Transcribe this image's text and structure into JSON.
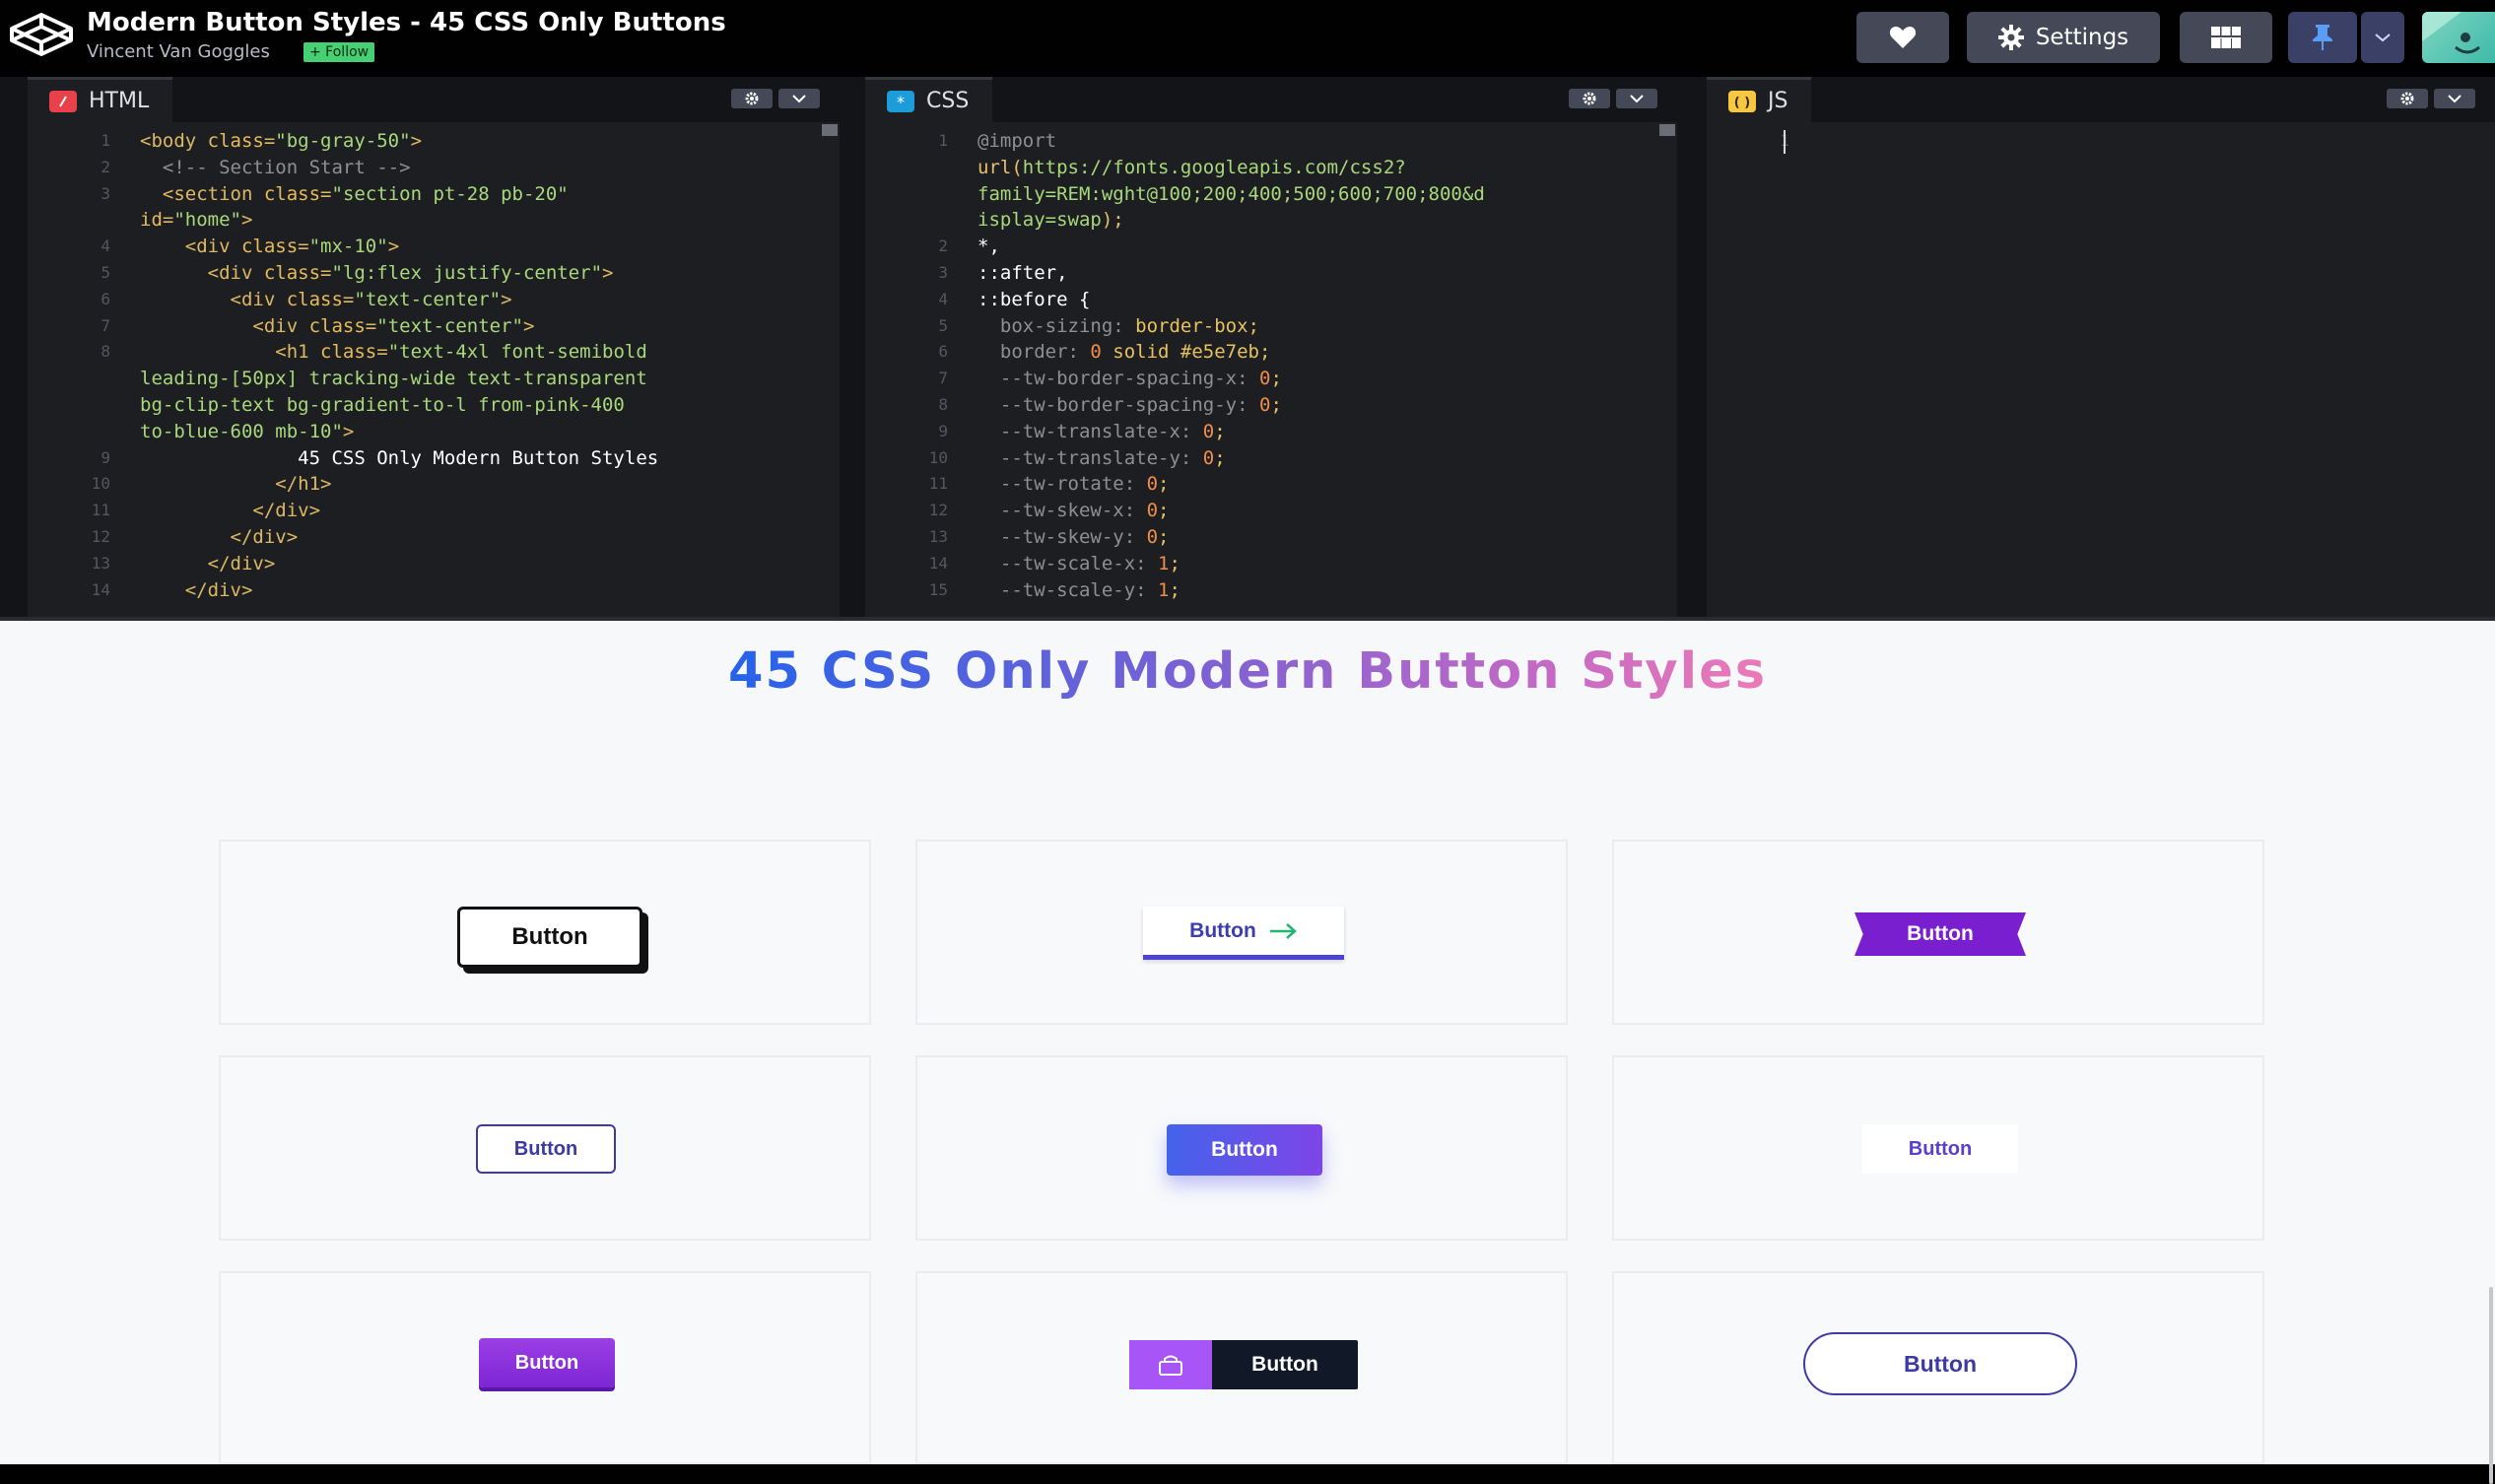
{
  "header": {
    "title": "Modern Button Styles - 45 CSS Only Buttons",
    "author": "Vincent Van Goggles",
    "follow_label": "+ Follow",
    "settings_label": "Settings"
  },
  "panes": {
    "html": {
      "label": "HTML",
      "lines": [
        {
          "n": "1",
          "parts": [
            {
              "c": "tag",
              "t": "<body "
            },
            {
              "c": "attr",
              "t": "class"
            },
            {
              "c": "tag",
              "t": "="
            },
            {
              "c": "str",
              "t": "\"bg-gray-50\""
            },
            {
              "c": "tag",
              "t": ">"
            }
          ]
        },
        {
          "n": "2",
          "parts": [
            {
              "c": "cmt",
              "t": "  <!-- Section Start -->"
            }
          ]
        },
        {
          "n": "3",
          "parts": [
            {
              "c": "tag",
              "t": "  <section "
            },
            {
              "c": "attr",
              "t": "class"
            },
            {
              "c": "tag",
              "t": "="
            },
            {
              "c": "str",
              "t": "\"section pt-28 pb-20\""
            }
          ]
        },
        {
          "n": "",
          "parts": [
            {
              "c": "attr",
              "t": "id"
            },
            {
              "c": "tag",
              "t": "="
            },
            {
              "c": "str",
              "t": "\"home\""
            },
            {
              "c": "tag",
              "t": ">"
            }
          ]
        },
        {
          "n": "4",
          "parts": [
            {
              "c": "tag",
              "t": "    <div "
            },
            {
              "c": "attr",
              "t": "class"
            },
            {
              "c": "tag",
              "t": "="
            },
            {
              "c": "str",
              "t": "\"mx-10\""
            },
            {
              "c": "tag",
              "t": ">"
            }
          ]
        },
        {
          "n": "5",
          "parts": [
            {
              "c": "tag",
              "t": "      <div "
            },
            {
              "c": "attr",
              "t": "class"
            },
            {
              "c": "tag",
              "t": "="
            },
            {
              "c": "str",
              "t": "\"lg:flex justify-center\""
            },
            {
              "c": "tag",
              "t": ">"
            }
          ]
        },
        {
          "n": "6",
          "parts": [
            {
              "c": "tag",
              "t": "        <div "
            },
            {
              "c": "attr",
              "t": "class"
            },
            {
              "c": "tag",
              "t": "="
            },
            {
              "c": "str",
              "t": "\"text-center\""
            },
            {
              "c": "tag",
              "t": ">"
            }
          ]
        },
        {
          "n": "7",
          "parts": [
            {
              "c": "tag",
              "t": "          <div "
            },
            {
              "c": "attr",
              "t": "class"
            },
            {
              "c": "tag",
              "t": "="
            },
            {
              "c": "str",
              "t": "\"text-center\""
            },
            {
              "c": "tag",
              "t": ">"
            }
          ]
        },
        {
          "n": "8",
          "parts": [
            {
              "c": "tag",
              "t": "            <h1 "
            },
            {
              "c": "attr",
              "t": "class"
            },
            {
              "c": "tag",
              "t": "="
            },
            {
              "c": "str",
              "t": "\"text-4xl font-semibold"
            }
          ]
        },
        {
          "n": "",
          "parts": [
            {
              "c": "str",
              "t": "leading-[50px] tracking-wide text-transparent"
            }
          ]
        },
        {
          "n": "",
          "parts": [
            {
              "c": "str",
              "t": "bg-clip-text bg-gradient-to-l from-pink-400"
            }
          ]
        },
        {
          "n": "",
          "parts": [
            {
              "c": "str",
              "t": "to-blue-600 mb-10\""
            },
            {
              "c": "tag",
              "t": ">"
            }
          ]
        },
        {
          "n": "9",
          "parts": [
            {
              "c": "plain",
              "t": "              45 CSS Only Modern Button Styles"
            }
          ]
        },
        {
          "n": "10",
          "parts": [
            {
              "c": "tag",
              "t": "            </h1>"
            }
          ]
        },
        {
          "n": "11",
          "parts": [
            {
              "c": "tag",
              "t": "          </div>"
            }
          ]
        },
        {
          "n": "12",
          "parts": [
            {
              "c": "tag",
              "t": "        </div>"
            }
          ]
        },
        {
          "n": "13",
          "parts": [
            {
              "c": "tag",
              "t": "      </div>"
            }
          ]
        },
        {
          "n": "14",
          "parts": [
            {
              "c": "tag",
              "t": "    </div>"
            }
          ]
        }
      ]
    },
    "css": {
      "label": "CSS",
      "lines": [
        {
          "n": "1",
          "parts": [
            {
              "c": "cmt",
              "t": "@import"
            }
          ]
        },
        {
          "n": "",
          "parts": [
            {
              "c": "kw",
              "t": "url("
            },
            {
              "c": "str",
              "t": "https://fonts.googleapis.com/css2?"
            }
          ]
        },
        {
          "n": "",
          "parts": [
            {
              "c": "str",
              "t": "family=REM:wght@100;200;400;500;600;700;800&d"
            }
          ]
        },
        {
          "n": "",
          "parts": [
            {
              "c": "str",
              "t": "isplay=swap"
            },
            {
              "c": "kw",
              "t": ");"
            }
          ]
        },
        {
          "n": "2",
          "parts": [
            {
              "c": "sel",
              "t": "*,"
            }
          ]
        },
        {
          "n": "3",
          "parts": [
            {
              "c": "sel",
              "t": "::after,"
            }
          ]
        },
        {
          "n": "4",
          "parts": [
            {
              "c": "sel",
              "t": "::before {"
            }
          ]
        },
        {
          "n": "5",
          "parts": [
            {
              "c": "cmt",
              "t": "  box-sizing: "
            },
            {
              "c": "prop",
              "t": "border-box;"
            }
          ]
        },
        {
          "n": "6",
          "parts": [
            {
              "c": "cmt",
              "t": "  border: "
            },
            {
              "c": "num",
              "t": "0"
            },
            {
              "c": "prop",
              "t": " solid #e5e7eb;"
            }
          ]
        },
        {
          "n": "7",
          "parts": [
            {
              "c": "cmt",
              "t": "  --tw-border-spacing-x: "
            },
            {
              "c": "num",
              "t": "0"
            },
            {
              "c": "prop",
              "t": ";"
            }
          ]
        },
        {
          "n": "8",
          "parts": [
            {
              "c": "cmt",
              "t": "  --tw-border-spacing-y: "
            },
            {
              "c": "num",
              "t": "0"
            },
            {
              "c": "prop",
              "t": ";"
            }
          ]
        },
        {
          "n": "9",
          "parts": [
            {
              "c": "cmt",
              "t": "  --tw-translate-x: "
            },
            {
              "c": "num",
              "t": "0"
            },
            {
              "c": "prop",
              "t": ";"
            }
          ]
        },
        {
          "n": "10",
          "parts": [
            {
              "c": "cmt",
              "t": "  --tw-translate-y: "
            },
            {
              "c": "num",
              "t": "0"
            },
            {
              "c": "prop",
              "t": ";"
            }
          ]
        },
        {
          "n": "11",
          "parts": [
            {
              "c": "cmt",
              "t": "  --tw-rotate: "
            },
            {
              "c": "num",
              "t": "0"
            },
            {
              "c": "prop",
              "t": ";"
            }
          ]
        },
        {
          "n": "12",
          "parts": [
            {
              "c": "cmt",
              "t": "  --tw-skew-x: "
            },
            {
              "c": "num",
              "t": "0"
            },
            {
              "c": "prop",
              "t": ";"
            }
          ]
        },
        {
          "n": "13",
          "parts": [
            {
              "c": "cmt",
              "t": "  --tw-skew-y: "
            },
            {
              "c": "num",
              "t": "0"
            },
            {
              "c": "prop",
              "t": ";"
            }
          ]
        },
        {
          "n": "14",
          "parts": [
            {
              "c": "cmt",
              "t": "  --tw-scale-x: "
            },
            {
              "c": "num",
              "t": "1"
            },
            {
              "c": "prop",
              "t": ";"
            }
          ]
        },
        {
          "n": "15",
          "parts": [
            {
              "c": "cmt",
              "t": "  --tw-scale-y: "
            },
            {
              "c": "num",
              "t": "1"
            },
            {
              "c": "prop",
              "t": ";"
            }
          ]
        }
      ]
    },
    "js": {
      "label": "JS",
      "lines": [
        {
          "n": "1",
          "parts": []
        }
      ]
    }
  },
  "preview": {
    "title": "45 CSS Only Modern Button Styles",
    "button_label": "Button"
  },
  "colors": {
    "accent_purple": "#7a1fd0",
    "brand_green": "#47cf73"
  },
  "icons": {
    "logo": "codepen-logo-icon",
    "heart": "heart-icon",
    "settings": "gear-icon",
    "layout": "layout-grid-icon",
    "pin": "pin-icon",
    "menu": "chevron-down-icon",
    "arrow": "arrow-right-icon",
    "lock": "lock-icon"
  }
}
